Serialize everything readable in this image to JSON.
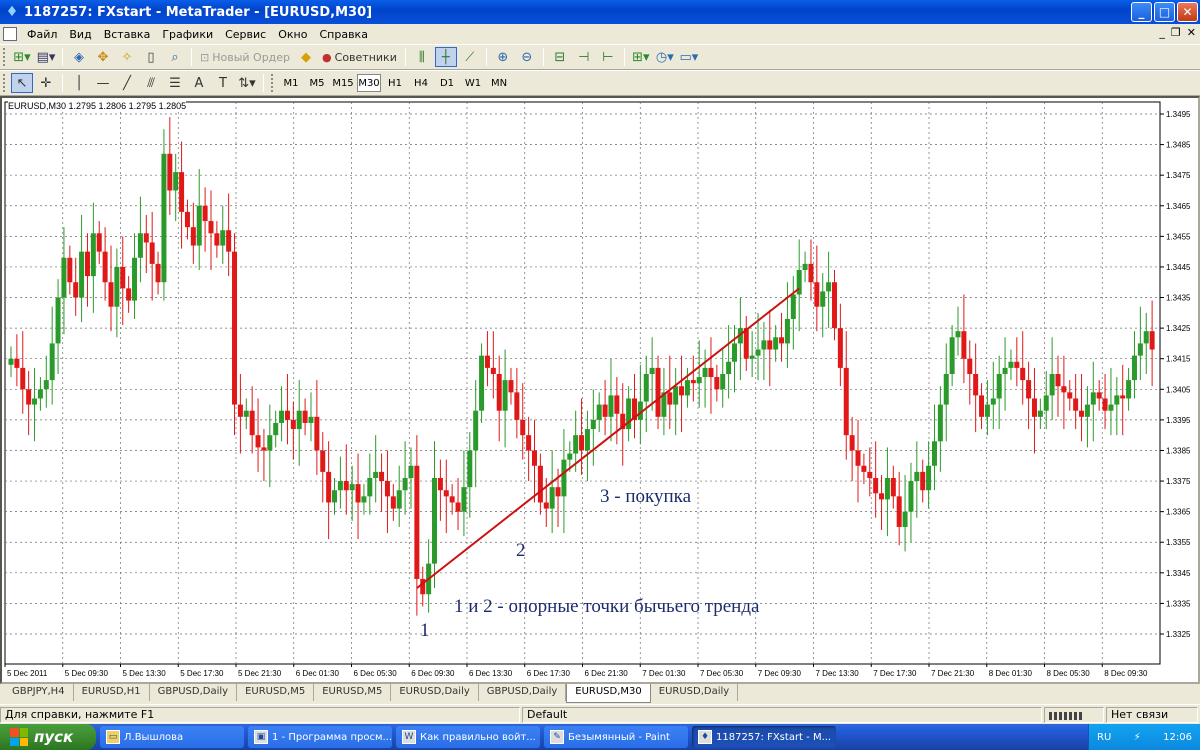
{
  "window": {
    "title": "1187257: FXstart - MetaTrader - [EURUSD,M30]",
    "buttons": {
      "minimize": "_",
      "maximize": "□",
      "close": "✕"
    }
  },
  "menu": [
    "Файл",
    "Вид",
    "Вставка",
    "Графики",
    "Сервис",
    "Окно",
    "Справка"
  ],
  "toolbar": {
    "new_order": "Новый Ордер",
    "advisors": "Советники",
    "timeframes": [
      "M1",
      "M5",
      "M15",
      "M30",
      "H1",
      "H4",
      "D1",
      "W1",
      "MN"
    ],
    "active_timeframe": "M30"
  },
  "chart": {
    "header": "EURUSD,M30  1.2795 1.2806 1.2795 1.2805",
    "annotations": {
      "point1": "1",
      "point2": "2",
      "buy": "3 - покупка",
      "note": "1 и 2 - опорные точки бычьего тренда"
    }
  },
  "chart_data": {
    "type": "candlestick",
    "symbol": "EURUSD",
    "timeframe": "M30",
    "ylim": [
      1.3325,
      1.3495
    ],
    "y_ticks": [
      "1.3495",
      "1.3485",
      "1.3475",
      "1.3465",
      "1.3455",
      "1.3445",
      "1.3435",
      "1.3425",
      "1.3415",
      "1.3405",
      "1.3395",
      "1.3385",
      "1.3375",
      "1.3365",
      "1.3355",
      "1.3345",
      "1.3335",
      "1.3325"
    ],
    "x_ticks": [
      "5 Dec 2011",
      "5 Dec 09:30",
      "5 Dec 13:30",
      "5 Dec 17:30",
      "5 Dec 21:30",
      "6 Dec 01:30",
      "6 Dec 05:30",
      "6 Dec 09:30",
      "6 Dec 13:30",
      "6 Dec 17:30",
      "6 Dec 21:30",
      "7 Dec 01:30",
      "7 Dec 05:30",
      "7 Dec 09:30",
      "7 Dec 13:30",
      "7 Dec 17:30",
      "7 Dec 21:30",
      "8 Dec 01:30",
      "8 Dec 05:30",
      "8 Dec 09:30"
    ],
    "colors": {
      "bull": "#2a9a2a",
      "bear": "#e01818",
      "grid": "#6a6a6a",
      "trendline": "#cc1111"
    },
    "grid": true,
    "trendline": {
      "from_bar": 69,
      "from_price": 1.334,
      "to_bar": 134,
      "to_price": 1.3438
    },
    "closes": [
      1.3415,
      1.3412,
      1.3405,
      1.34,
      1.3402,
      1.3405,
      1.3408,
      1.342,
      1.3435,
      1.3448,
      1.344,
      1.3435,
      1.345,
      1.3442,
      1.3456,
      1.345,
      1.344,
      1.3432,
      1.3445,
      1.3438,
      1.3434,
      1.3448,
      1.3456,
      1.3453,
      1.3446,
      1.344,
      1.3482,
      1.347,
      1.3476,
      1.3463,
      1.3458,
      1.3452,
      1.3465,
      1.346,
      1.3456,
      1.3452,
      1.3457,
      1.345,
      1.34,
      1.3396,
      1.3398,
      1.339,
      1.3386,
      1.3385,
      1.339,
      1.3394,
      1.3398,
      1.3395,
      1.3392,
      1.3398,
      1.3394,
      1.3396,
      1.3385,
      1.3378,
      1.3368,
      1.3372,
      1.3375,
      1.3372,
      1.3374,
      1.3368,
      1.337,
      1.3376,
      1.3378,
      1.3375,
      1.337,
      1.3366,
      1.3372,
      1.3376,
      1.338,
      1.3343,
      1.3338,
      1.3348,
      1.3376,
      1.3372,
      1.337,
      1.3368,
      1.3365,
      1.3373,
      1.3385,
      1.3398,
      1.3416,
      1.3412,
      1.341,
      1.3398,
      1.3408,
      1.3404,
      1.3395,
      1.339,
      1.3385,
      1.338,
      1.3368,
      1.3366,
      1.3373,
      1.337,
      1.3382,
      1.3384,
      1.339,
      1.3385,
      1.3392,
      1.3395,
      1.34,
      1.3396,
      1.3403,
      1.3397,
      1.3392,
      1.3402,
      1.3395,
      1.3401,
      1.341,
      1.3412,
      1.3396,
      1.3404,
      1.34,
      1.3406,
      1.3403,
      1.3408,
      1.3407,
      1.3409,
      1.3412,
      1.3409,
      1.3405,
      1.341,
      1.3414,
      1.342,
      1.3425,
      1.3415,
      1.3416,
      1.3418,
      1.3421,
      1.3418,
      1.3422,
      1.342,
      1.3428,
      1.3436,
      1.3444,
      1.3446,
      1.344,
      1.3432,
      1.3437,
      1.344,
      1.3425,
      1.3412,
      1.339,
      1.3385,
      1.338,
      1.3378,
      1.3376,
      1.3371,
      1.3369,
      1.3376,
      1.337,
      1.336,
      1.3365,
      1.3375,
      1.3378,
      1.3372,
      1.338,
      1.3388,
      1.34,
      1.341,
      1.3422,
      1.3424,
      1.3415,
      1.341,
      1.3403,
      1.3396,
      1.34,
      1.3402,
      1.341,
      1.3412,
      1.3414,
      1.3412,
      1.3408,
      1.3402,
      1.3396,
      1.3398,
      1.3403,
      1.341,
      1.3406,
      1.3404,
      1.3402,
      1.3398,
      1.3396,
      1.34,
      1.3404,
      1.3402,
      1.3398,
      1.34,
      1.3403,
      1.3402,
      1.3408,
      1.3416,
      1.342,
      1.3424,
      1.3418
    ]
  },
  "chart_tabs": [
    "GBPJPY,H4",
    "EURUSD,H1",
    "GBPUSD,Daily",
    "EURUSD,M5",
    "EURUSD,M5",
    "EURUSD,Daily",
    "GBPUSD,Daily",
    "EURUSD,M30",
    "EURUSD,Daily"
  ],
  "active_chart_tab": "EURUSD,M30",
  "status": {
    "help": "Для справки, нажмите F1",
    "profile": "Default",
    "connection": "Нет связи"
  },
  "taskbar": {
    "start": "пуск",
    "tasks": [
      "Л.Вышлова",
      "1 - Программа просм...",
      "Как правильно войт...",
      "Безымянный - Paint",
      "1187257: FXstart - M..."
    ],
    "lang": "RU",
    "clock": "12:06"
  }
}
